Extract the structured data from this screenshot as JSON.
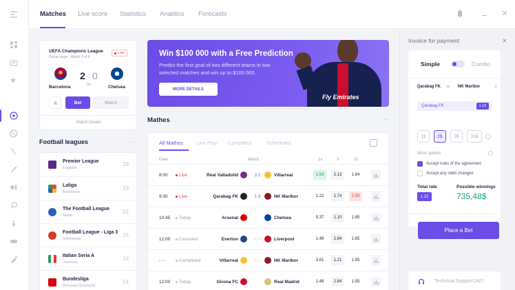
{
  "nav": {
    "items": [
      "Matches",
      "Live score",
      "Statistics",
      "Analitics",
      "Forecasts"
    ]
  },
  "featured": {
    "competition": "UEFA Champions League",
    "stage": "Group stage · Match 3 of 6",
    "live": "Live",
    "home": "Barcelona",
    "away": "Chelsea",
    "home_score": "2",
    "away_score": "0",
    "minute": "1st",
    "bet": "Bet",
    "watch": "Watch",
    "details": "Match Details"
  },
  "banner": {
    "title": "Win $100 000 with a Free Prediction",
    "text": "Predict the first goal of two different teams in two selected matches and win up to $100 000.",
    "button": "MORE DETAILS",
    "jersey": "Fly Emirates"
  },
  "leagues": {
    "title": "Football leagues",
    "items": [
      {
        "name": "Premier League",
        "sub": "England",
        "count": "29",
        "color": "#5b2a86"
      },
      {
        "name": "Laliga",
        "sub": "Barcelona",
        "count": "13",
        "color": "#e9483a"
      },
      {
        "name": "The Football League",
        "sub": "Spain",
        "count": "52",
        "color": "#2b5fb4"
      },
      {
        "name": "Football League - Liga 3",
        "sub": "Indonesian",
        "count": "25",
        "color": "#d63b2b"
      },
      {
        "name": "Italian Seria A",
        "sub": "Juventus",
        "count": "16",
        "color": "#2a9d5c"
      },
      {
        "name": "Bundesliga",
        "sub": "Borussia Dortmund",
        "count": "54",
        "color": "#d20515"
      }
    ]
  },
  "matches": {
    "title": "Mathes",
    "tabs": [
      "All Mathes",
      "Live Play",
      "Complited",
      "Scheduled"
    ],
    "headers": {
      "date": "Date",
      "match": "Match",
      "x1": "1x",
      "x": "X",
      "x2": "2x"
    },
    "rows": [
      {
        "time": "8:00",
        "status": "Live",
        "home": "Real Valladolid",
        "score": "3  2",
        "away": "Villarreal",
        "o1": "1.63",
        "ox": "2.13",
        "o2": "1.84",
        "hc": "#7a2c8a",
        "ac": "#f2c230",
        "hl1": "green",
        "hl2": "plain"
      },
      {
        "time": "9:30",
        "status": "Live",
        "home": "Qarabag FK",
        "score": "1  0",
        "away": "NK Maribor",
        "o1": "1.22",
        "ox": "1.74",
        "o2": "2.55",
        "hc": "#222",
        "ac": "#8b1b2b",
        "hl1": "plain",
        "hl2": "red"
      },
      {
        "time": "10:45",
        "status": "Today",
        "home": "Arsenal",
        "score": "",
        "away": "Chelsea",
        "o1": "5.37",
        "ox": "1.10",
        "o2": "1.85",
        "hc": "#db0007",
        "ac": "#034694",
        "hl1": "plain",
        "hl2": "plain"
      },
      {
        "time": "12:00",
        "status": "Canceled",
        "home": "Everton",
        "score": "- : -",
        "away": "Liverpool",
        "o1": "1.48",
        "ox": "2.84",
        "o2": "1.65",
        "hc": "#274488",
        "ac": "#c8102e",
        "hl1": "plain",
        "hl2": "plain"
      },
      {
        "time": "- : -",
        "status": "Completed",
        "home": "Villarreal",
        "score": "- : -",
        "away": "NK Maribor",
        "o1": "3.61",
        "ox": "1.21",
        "o2": "1.55",
        "hc": "#f2c230",
        "ac": "#8b1b2b",
        "hl1": "plain",
        "hl2": "plain"
      },
      {
        "time": "12:00",
        "status": "Today",
        "home": "Girona FC",
        "score": "",
        "away": "Real Madrid",
        "o1": "1.48",
        "ox": "2.84",
        "o2": "1.55",
        "hc": "#c8102e",
        "ac": "#d8c27a",
        "hl1": "plain",
        "hl2": "plain"
      }
    ]
  },
  "invoice": {
    "title": "Invoice for payment",
    "simple": "Simple",
    "combo": "Combo",
    "pick_home": "Qarabag FK",
    "vs": "vs",
    "pick_away": "NK Maribor",
    "pick": "Qarabag FK",
    "pick_odd": "1.22",
    "stakes": [
      "1$",
      "2$",
      "5$",
      "20$"
    ],
    "more": "More options",
    "opt1": "Accept rules of the agreement",
    "opt2": "Accept any odds changes",
    "total_label": "Total rate",
    "total": "1.22",
    "win_label": "Possible winnings",
    "win": "735,48$",
    "place": "Place a Bet",
    "support": "Technical Support 24/7"
  },
  "colors": {
    "accent": "#6b4ce6",
    "live": "#e04848",
    "win": "#1fa86a"
  }
}
